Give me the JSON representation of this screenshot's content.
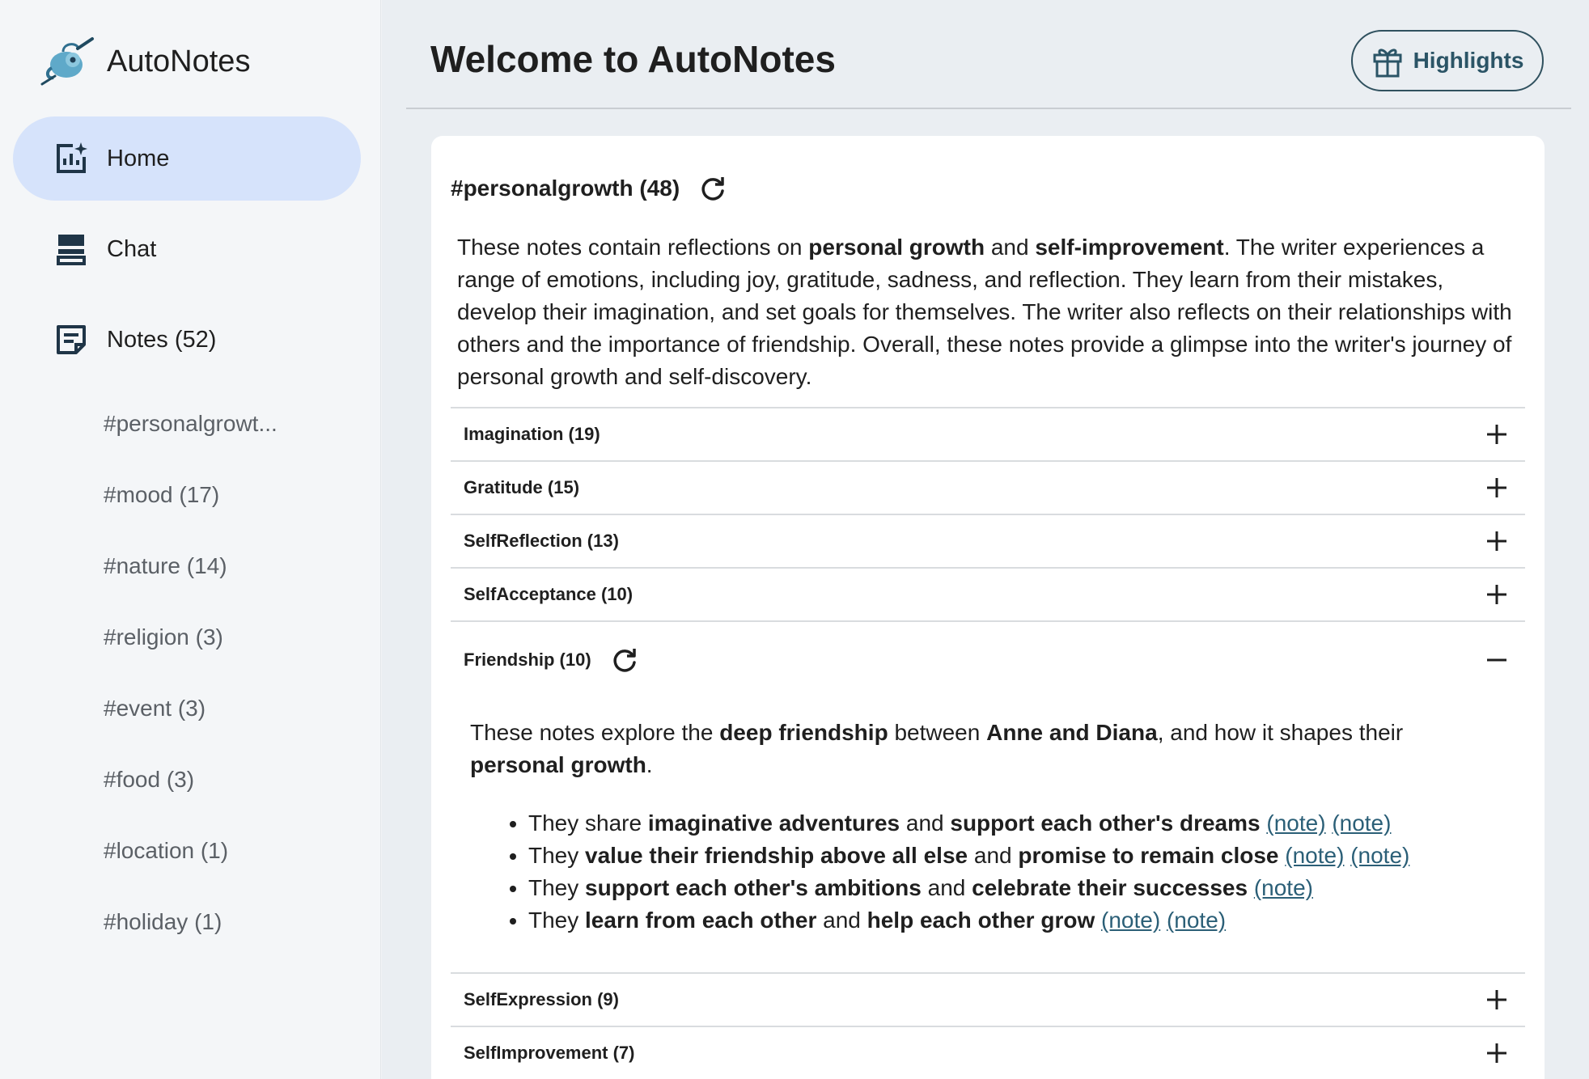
{
  "brand": {
    "name": "AutoNotes"
  },
  "nav": {
    "home": "Home",
    "chat": "Chat",
    "notes": "Notes (52)"
  },
  "tags": [
    "#personalgrowt...",
    "#mood (17)",
    "#nature (14)",
    "#religion (3)",
    "#event (3)",
    "#food (3)",
    "#location (1)",
    "#holiday (1)"
  ],
  "header": {
    "title": "Welcome to AutoNotes",
    "highlights_label": "Highlights"
  },
  "card": {
    "title": "#personalgrowth (48)",
    "summary": {
      "p1": "These notes contain reflections on ",
      "b1": "personal growth",
      "p2": " and ",
      "b2": "self-improvement",
      "p3": ". The writer experiences a range of emotions, including joy, gratitude, sadness, and reflection. They learn from their mistakes, develop their imagination, and set goals for themselves. The writer also reflects on their relationships with others and the importance of friendship. Overall, these notes provide a glimpse into the writer's journey of personal growth and self-discovery."
    },
    "sections": [
      {
        "label": "Imagination (19)"
      },
      {
        "label": "Gratitude (15)"
      },
      {
        "label": "SelfReflection (13)"
      },
      {
        "label": "SelfAcceptance (10)"
      },
      {
        "label": "Friendship (10)"
      },
      {
        "label": "SelfExpression (9)"
      },
      {
        "label": "SelfImprovement (7)"
      }
    ],
    "friendship": {
      "summary": {
        "p1": "These notes explore the ",
        "b1": "deep friendship",
        "p2": " between ",
        "b2": "Anne and Diana",
        "p3": ", and how it shapes their ",
        "b3": "personal growth",
        "p4": "."
      },
      "bullets": [
        {
          "t1": "They share ",
          "b1": "imaginative adventures",
          "t2": " and ",
          "b2": "support each other's dreams",
          "link1": "(note)",
          "link2": "(note)"
        },
        {
          "t1": "They ",
          "b1": "value their friendship above all else",
          "t2": " and ",
          "b2": "promise to remain close",
          "link1": "(note)",
          "link2": "(note)"
        },
        {
          "t1": "They ",
          "b1": "support each other's ambitions",
          "t2": " and ",
          "b2": "celebrate their successes",
          "link1": "(note)"
        },
        {
          "t1": "They ",
          "b1": "learn from each other",
          "t2": " and ",
          "b2": "help each other grow",
          "link1": "(note)",
          "link2": "(note)"
        }
      ]
    }
  },
  "colors": {
    "active_nav": "#d6e3fb",
    "link": "#2b5f77",
    "highlights_border": "#30515f"
  }
}
